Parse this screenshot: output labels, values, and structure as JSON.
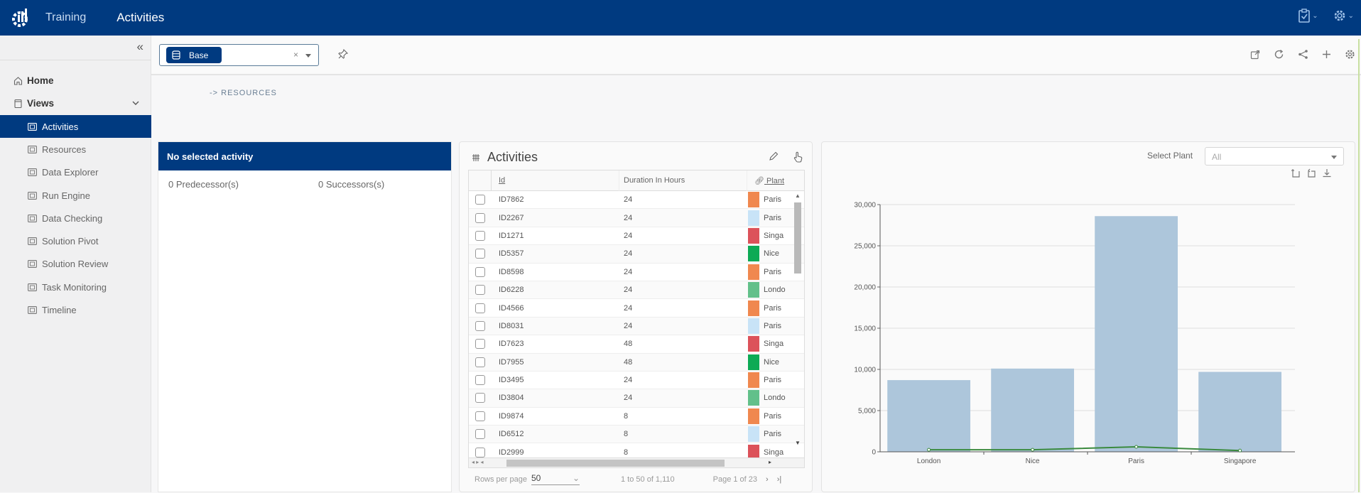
{
  "header": {
    "app_name": "Training",
    "page_title": "Activities",
    "icons": [
      "clipboard-check-icon",
      "gear-icon"
    ]
  },
  "sidebar": {
    "collapse_icon": "double-chevron-left-icon",
    "home_label": "Home",
    "views_label": "Views",
    "items": [
      {
        "label": "Activities",
        "active": true
      },
      {
        "label": "Resources",
        "active": false
      },
      {
        "label": "Data Explorer",
        "active": false
      },
      {
        "label": "Run Engine",
        "active": false
      },
      {
        "label": "Data Checking",
        "active": false
      },
      {
        "label": "Solution Pivot",
        "active": false
      },
      {
        "label": "Solution Review",
        "active": false
      },
      {
        "label": "Task Monitoring",
        "active": false
      },
      {
        "label": "Timeline",
        "active": false
      }
    ]
  },
  "toolbar": {
    "scenario_chip": "Base",
    "clear_symbol": "×",
    "actions": [
      "open-external-icon",
      "refresh-icon",
      "share-icon",
      "plus-icon",
      "settings-icon"
    ]
  },
  "breadcrumb": "-> RESOURCES",
  "selection_panel": {
    "header": "No selected activity",
    "predecessors": "0 Predecessor(s)",
    "successors": "0 Successors(s)"
  },
  "activities_panel": {
    "title": "Activities",
    "columns": [
      "Id",
      "Duration In Hours",
      "Plant"
    ],
    "rows": [
      {
        "id": "ID7862",
        "duration": "24",
        "plant": "Paris",
        "color": "#f0884f"
      },
      {
        "id": "ID2267",
        "duration": "24",
        "plant": "Paris",
        "color": "#c8e3f7"
      },
      {
        "id": "ID1271",
        "duration": "24",
        "plant": "Singa",
        "color": "#dc525a"
      },
      {
        "id": "ID5357",
        "duration": "24",
        "plant": "Nice",
        "color": "#0daa55"
      },
      {
        "id": "ID8598",
        "duration": "24",
        "plant": "Paris",
        "color": "#f0884f"
      },
      {
        "id": "ID6228",
        "duration": "24",
        "plant": "Londo",
        "color": "#62c08a"
      },
      {
        "id": "ID4566",
        "duration": "24",
        "plant": "Paris",
        "color": "#f0884f"
      },
      {
        "id": "ID8031",
        "duration": "24",
        "plant": "Paris",
        "color": "#c8e3f7"
      },
      {
        "id": "ID7623",
        "duration": "48",
        "plant": "Singa",
        "color": "#dc525a"
      },
      {
        "id": "ID7955",
        "duration": "48",
        "plant": "Nice",
        "color": "#0daa55"
      },
      {
        "id": "ID3495",
        "duration": "24",
        "plant": "Paris",
        "color": "#f0884f"
      },
      {
        "id": "ID3804",
        "duration": "24",
        "plant": "Londo",
        "color": "#62c08a"
      },
      {
        "id": "ID9874",
        "duration": "8",
        "plant": "Paris",
        "color": "#f0884f"
      },
      {
        "id": "ID6512",
        "duration": "8",
        "plant": "Paris",
        "color": "#c8e3f7"
      },
      {
        "id": "ID2999",
        "duration": "8",
        "plant": "Singa",
        "color": "#dc525a"
      }
    ],
    "pager": {
      "rows_per_page_label": "Rows per page",
      "rows_per_page": "50",
      "range": "1 to 50 of 1,110",
      "page": "Page 1 of 23",
      "next": "›",
      "last": "›|"
    }
  },
  "chart_panel": {
    "filter_label": "Select Plant",
    "filter_value": "All",
    "tools": [
      "zoom-in-icon",
      "zoom-reset-icon",
      "download-icon"
    ]
  },
  "chart_data": {
    "type": "bar",
    "title": "",
    "xlabel": "",
    "ylabel": "",
    "categories": [
      "London",
      "Nice",
      "Paris",
      "Singapore"
    ],
    "series": [
      {
        "name": "bars",
        "type": "bar",
        "color": "#adc6db",
        "values": [
          8700,
          10100,
          28600,
          9700
        ]
      },
      {
        "name": "line",
        "type": "line",
        "color": "#3a8a3e",
        "values": [
          250,
          250,
          600,
          150
        ]
      }
    ],
    "ylim": [
      0,
      30000
    ],
    "yticks": [
      "0",
      "5,000",
      "10,000",
      "15,000",
      "20,000",
      "25,000",
      "30,000"
    ],
    "grid": true,
    "legend": "none"
  }
}
